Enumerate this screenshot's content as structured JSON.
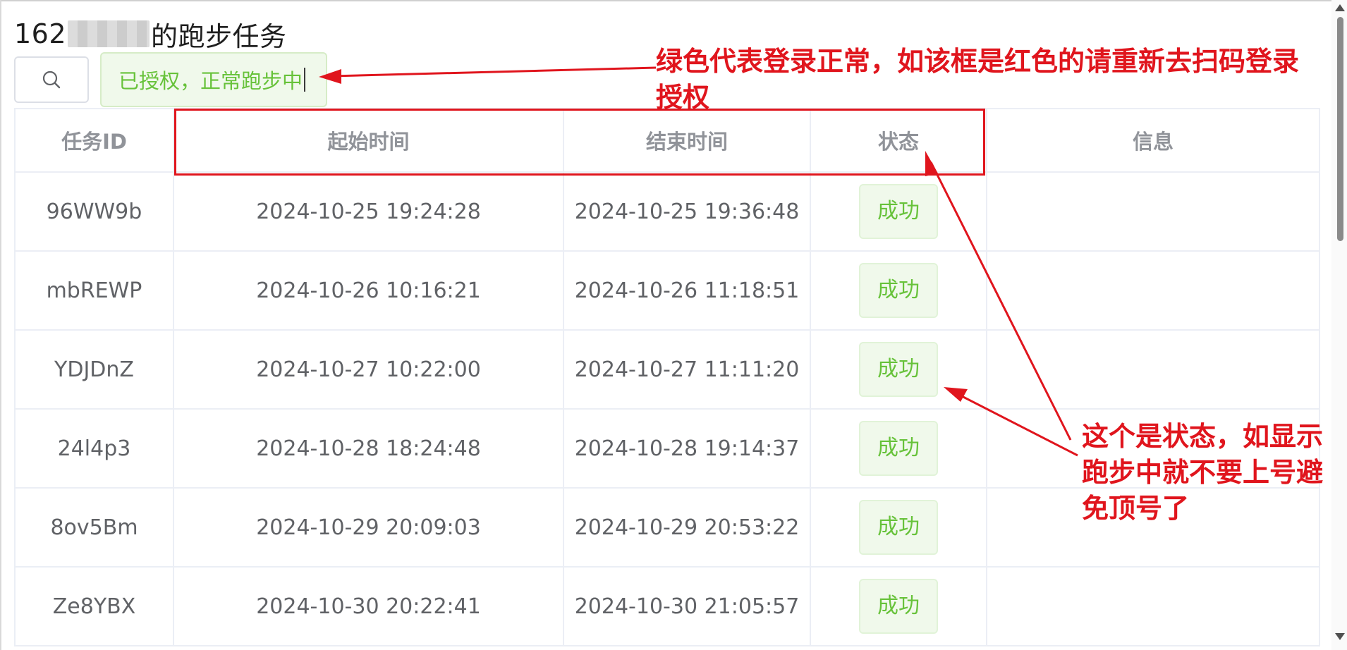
{
  "page": {
    "title_prefix": "162",
    "title_suffix": "的跑步任务"
  },
  "search": {
    "icon": "search-icon"
  },
  "status_box": {
    "text": "已授权，正常跑步中",
    "color": "#67c23a"
  },
  "table": {
    "columns": [
      "任务ID",
      "起始时间",
      "结束时间",
      "状态",
      "信息"
    ],
    "rows": [
      {
        "id": "96WW9b",
        "start": "2024-10-25 19:24:28",
        "end": "2024-10-25 19:36:48",
        "status": "成功",
        "info": ""
      },
      {
        "id": "mbREWP",
        "start": "2024-10-26 10:16:21",
        "end": "2024-10-26 11:18:51",
        "status": "成功",
        "info": ""
      },
      {
        "id": "YDJDnZ",
        "start": "2024-10-27 10:22:00",
        "end": "2024-10-27 11:11:20",
        "status": "成功",
        "info": ""
      },
      {
        "id": "24l4p3",
        "start": "2024-10-28 18:24:48",
        "end": "2024-10-28 19:14:37",
        "status": "成功",
        "info": ""
      },
      {
        "id": "8ov5Bm",
        "start": "2024-10-29 20:09:03",
        "end": "2024-10-29 20:53:22",
        "status": "成功",
        "info": ""
      },
      {
        "id": "Ze8YBX",
        "start": "2024-10-30 20:22:41",
        "end": "2024-10-30 21:05:57",
        "status": "成功",
        "info": ""
      }
    ]
  },
  "annotations": {
    "note_1": "绿色代表登录正常，如该框是红色的请重新去扫码登录授权",
    "note_2": "这个是状态，如显示跑步中就不要上号避免顶号了",
    "color": "#e0151d"
  }
}
